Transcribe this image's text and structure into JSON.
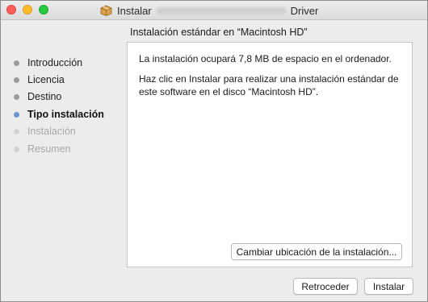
{
  "window": {
    "title_prefix": "Instalar",
    "title_suffix": "Driver"
  },
  "sidebar": {
    "steps": [
      {
        "label": "Introducción",
        "state": "done"
      },
      {
        "label": "Licencia",
        "state": "done"
      },
      {
        "label": "Destino",
        "state": "done"
      },
      {
        "label": "Tipo instalación",
        "state": "current"
      },
      {
        "label": "Instalación",
        "state": "pending"
      },
      {
        "label": "Resumen",
        "state": "pending"
      }
    ]
  },
  "main": {
    "heading": "Instalación estándar en “Macintosh HD”",
    "paragraph_1": "La instalación ocupará 7,8 MB de espacio en el ordenador.",
    "paragraph_2": "Haz clic en Instalar para realizar una instalación estándar de este software en el disco “Macintosh HD”.",
    "change_location_label": "Cambiar ubicación de la instalación..."
  },
  "footer": {
    "back_label": "Retroceder",
    "install_label": "Instalar"
  },
  "colors": {
    "active_step_dot": "#6a96d4",
    "close": "#fc5f57",
    "minimize": "#fdbc2e",
    "maximize": "#28c840"
  },
  "icons": {
    "title_icon": "package-icon"
  }
}
